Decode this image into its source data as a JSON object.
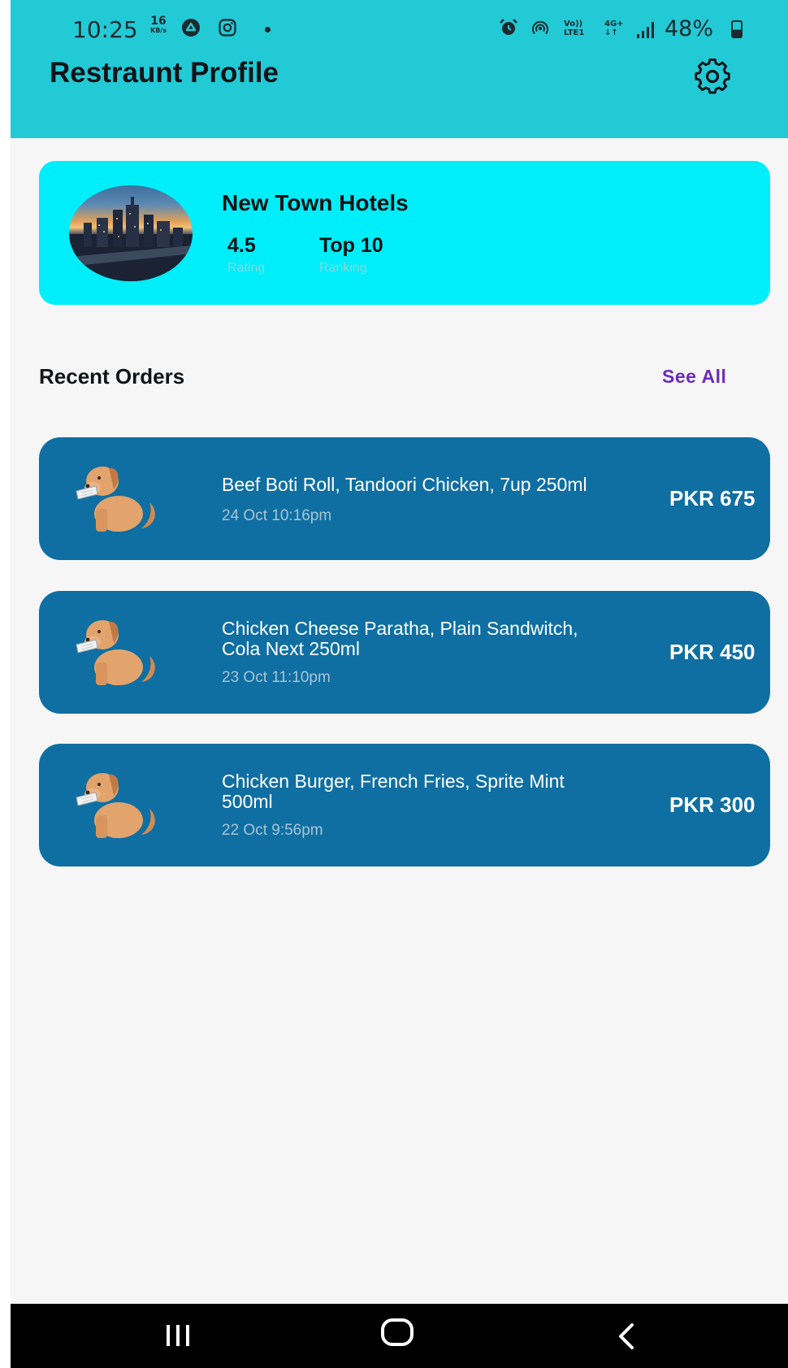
{
  "status_bar": {
    "time": "10:25",
    "speed_value": "16",
    "speed_unit": "KB/s",
    "net_top_1": "Vo))",
    "net_bottom_1": "LTE1",
    "net_top_2": "4G+",
    "net_bottom_2": "↓↑",
    "battery": "48%"
  },
  "header": {
    "title": "Restraunt Profile",
    "settings_icon": "gear-icon"
  },
  "profile": {
    "name": "New Town Hotels",
    "rating_value": "4.5",
    "rating_label": "Rating",
    "rank_value": "Top 10",
    "rank_label": "Ranking"
  },
  "recent_orders": {
    "title": "Recent Orders",
    "see_all": "See All",
    "orders": [
      {
        "items_line1": "Beef Boti Roll, Tandoori Chicken, 7up 250ml",
        "items_line2": "",
        "date": "24 Oct 10:16pm",
        "price": "PKR 675"
      },
      {
        "items_line1": "Chicken Cheese Paratha, Plain Sandwitch,",
        "items_line2": "Cola Next 250ml",
        "date": "23 Oct 11:10pm",
        "price": "PKR 450"
      },
      {
        "items_line1": "Chicken Burger, French Fries, Sprite Mint",
        "items_line2": "500ml",
        "date": "22 Oct 9:56pm",
        "price": "PKR 300"
      }
    ]
  },
  "colors": {
    "appbar": "#22cad6",
    "profile_card": "#00eef9",
    "order_card": "#0f6fa2",
    "see_all": "#6d2bb8"
  }
}
